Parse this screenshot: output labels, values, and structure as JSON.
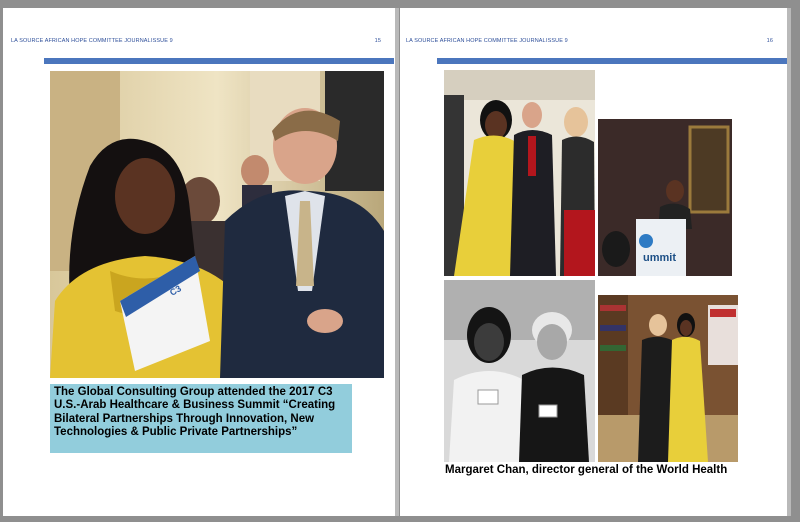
{
  "colors": {
    "accent_bar": "#4b76bd",
    "header_text": "#2e4f9a",
    "caption_bg": "#92cddc",
    "background": "#8f8f8f"
  },
  "left_page": {
    "header_title": "LA SOURCE AFRICAN HOPE COMMITTEE JOURNAL",
    "issue": "ISSUE 9",
    "page_number": "15",
    "caption": "The Global Consulting Group attended the 2017 C3 U.S.-Arab Healthcare & Business Summit “Creating Bilateral Partnerships Through Innovation, New Technologies & Public Private Partnerships”",
    "brochure_brand": "C3"
  },
  "right_page": {
    "header_title": "LA SOURCE AFRICAN HOPE COMMITTEE JOURNAL",
    "issue": "ISSUE 9",
    "page_number": "16",
    "caption": "Margaret Chan, director general of the World Health",
    "podium_sign": "ummit"
  }
}
